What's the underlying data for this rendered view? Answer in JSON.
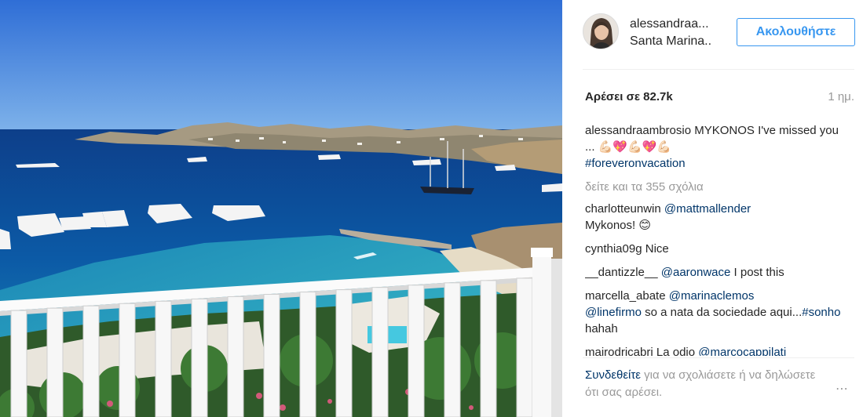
{
  "post": {
    "username_short": "alessandraa...",
    "location": "Santa Marina..",
    "follow_label": "Ακολουθήστε",
    "likes": "Αρέσει σε 82.7k",
    "time": "1 ημ.",
    "caption": {
      "user": "alessandraambrosio",
      "text": " MYKONOS I've missed you ... ",
      "emoji": "💪🏻💖💪🏻💖💪🏻",
      "hashtag": "#foreveronvacation"
    },
    "view_all": "δείτε και τα 355 σχόλια",
    "comments": [
      {
        "user": "charlotteunwin",
        "mention": "@mattmallender",
        "text": " Mykonos! 😊"
      },
      {
        "user": "cynthia09g",
        "mention": "",
        "text": " Nice"
      },
      {
        "user": "__dantizzle__",
        "mention": "@aaronwace",
        "text": " I post this"
      },
      {
        "user": "marcella_abate",
        "mention": "@marinaclemos",
        "mention2": "@linefirmo",
        "text": " so a nata da sociedade aqui...",
        "hashtag": "#sonho",
        "text2": " hahah"
      },
      {
        "user": "mairodricabri",
        "text": " La odio ",
        "mention": "@marcocappilati"
      }
    ],
    "login_link": "Συνδεθείτε",
    "login_rest": " για να σχολιάσετε ή να δηλώσετε ότι σας αρέσει.",
    "more_icon": "⋯"
  },
  "colors": {
    "accent": "#3897f0",
    "link": "#003569",
    "muted": "#999999",
    "text": "#262626"
  },
  "icons": {
    "more": "more-options-icon"
  }
}
